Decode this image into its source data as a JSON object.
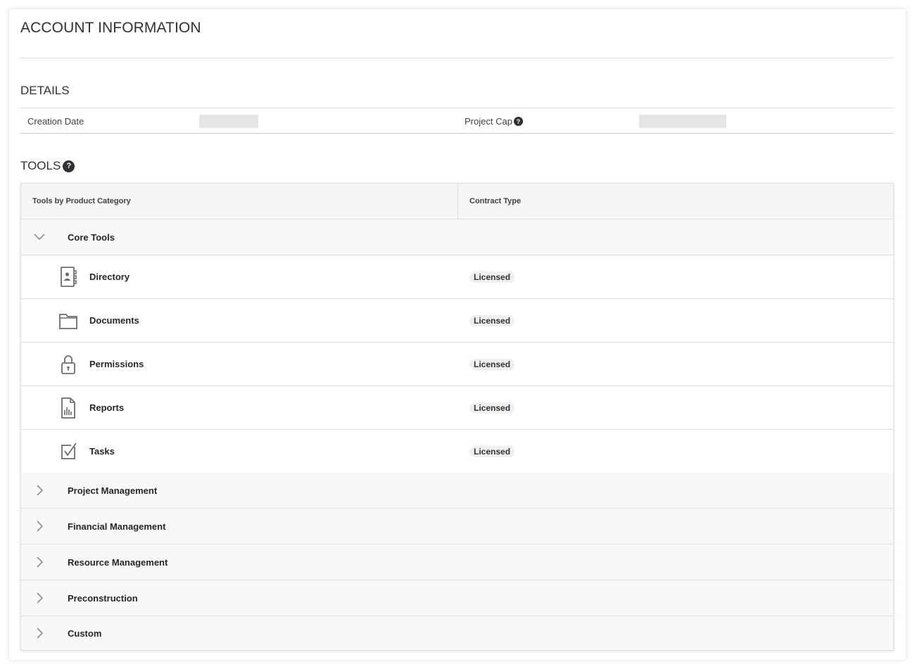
{
  "page": {
    "title": "ACCOUNT INFORMATION"
  },
  "details": {
    "section_title": "DETAILS",
    "creation_date_label": "Creation Date",
    "project_cap_label": "Project Cap"
  },
  "tools": {
    "section_title": "TOOLS",
    "columns": {
      "category": "Tools by Product Category",
      "contract": "Contract Type"
    },
    "core_group": "Core Tools",
    "items": [
      {
        "label": "Directory",
        "icon": "directory-icon",
        "contract": "Licensed"
      },
      {
        "label": "Documents",
        "icon": "folder-icon",
        "contract": "Licensed"
      },
      {
        "label": "Permissions",
        "icon": "lock-icon",
        "contract": "Licensed"
      },
      {
        "label": "Reports",
        "icon": "report-icon",
        "contract": "Licensed"
      },
      {
        "label": "Tasks",
        "icon": "checkbox-icon",
        "contract": "Licensed"
      }
    ],
    "groups": [
      "Project Management",
      "Financial Management",
      "Resource Management",
      "Preconstruction",
      "Custom"
    ]
  },
  "colors": {
    "text": "#232729",
    "border": "#dcdfe1",
    "header_bg": "#f4f5f5",
    "badge_bg": "#eeeff0",
    "icon": "#6a6e71"
  }
}
